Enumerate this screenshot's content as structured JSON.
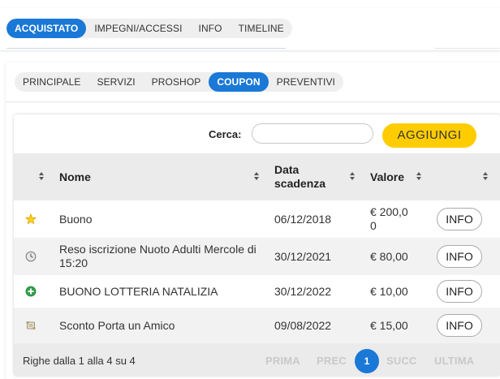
{
  "top_tabs": [
    {
      "label": "ACQUISTATO",
      "active": true
    },
    {
      "label": "IMPEGNI/ACCESSI",
      "active": false
    },
    {
      "label": "INFO",
      "active": false
    },
    {
      "label": "TIMELINE",
      "active": false
    }
  ],
  "sub_tabs": [
    {
      "label": "PRINCIPALE",
      "active": false
    },
    {
      "label": "SERVIZI",
      "active": false
    },
    {
      "label": "PROSHOP",
      "active": false
    },
    {
      "label": "COUPON",
      "active": true
    },
    {
      "label": "PREVENTIVI",
      "active": false
    }
  ],
  "search": {
    "label": "Cerca:",
    "value": ""
  },
  "add_button": "AGGIUNGI",
  "table": {
    "headers": {
      "name": "Nome",
      "expiry": "Data scadenza",
      "value": "Valore"
    },
    "rows": [
      {
        "icon": "star-icon",
        "name": "Buono",
        "expiry": "06/12/2018",
        "value": "€ 200,00",
        "action": "INFO"
      },
      {
        "icon": "clock-icon",
        "name": "Reso iscrizione Nuoto Adulti Mercole di 15:20",
        "expiry": "30/12/2021",
        "value": "€ 80,00",
        "action": "INFO"
      },
      {
        "icon": "plus-circle-icon",
        "name": "BUONO LOTTERIA NATALIZIA",
        "expiry": "30/12/2022",
        "value": "€ 10,00",
        "action": "INFO"
      },
      {
        "icon": "scroll-icon",
        "name": "Sconto Porta un Amico",
        "expiry": "09/08/2022",
        "value": "€ 15,00",
        "action": "INFO"
      }
    ]
  },
  "footer": {
    "count": "Righe dalla 1 alla 4 su 4",
    "first": "PRIMA",
    "prev": "PREC",
    "current": "1",
    "next": "SUCC",
    "last": "ULTIMA"
  },
  "colors": {
    "accent": "#1a78d6",
    "add_button": "#ffcc00"
  }
}
